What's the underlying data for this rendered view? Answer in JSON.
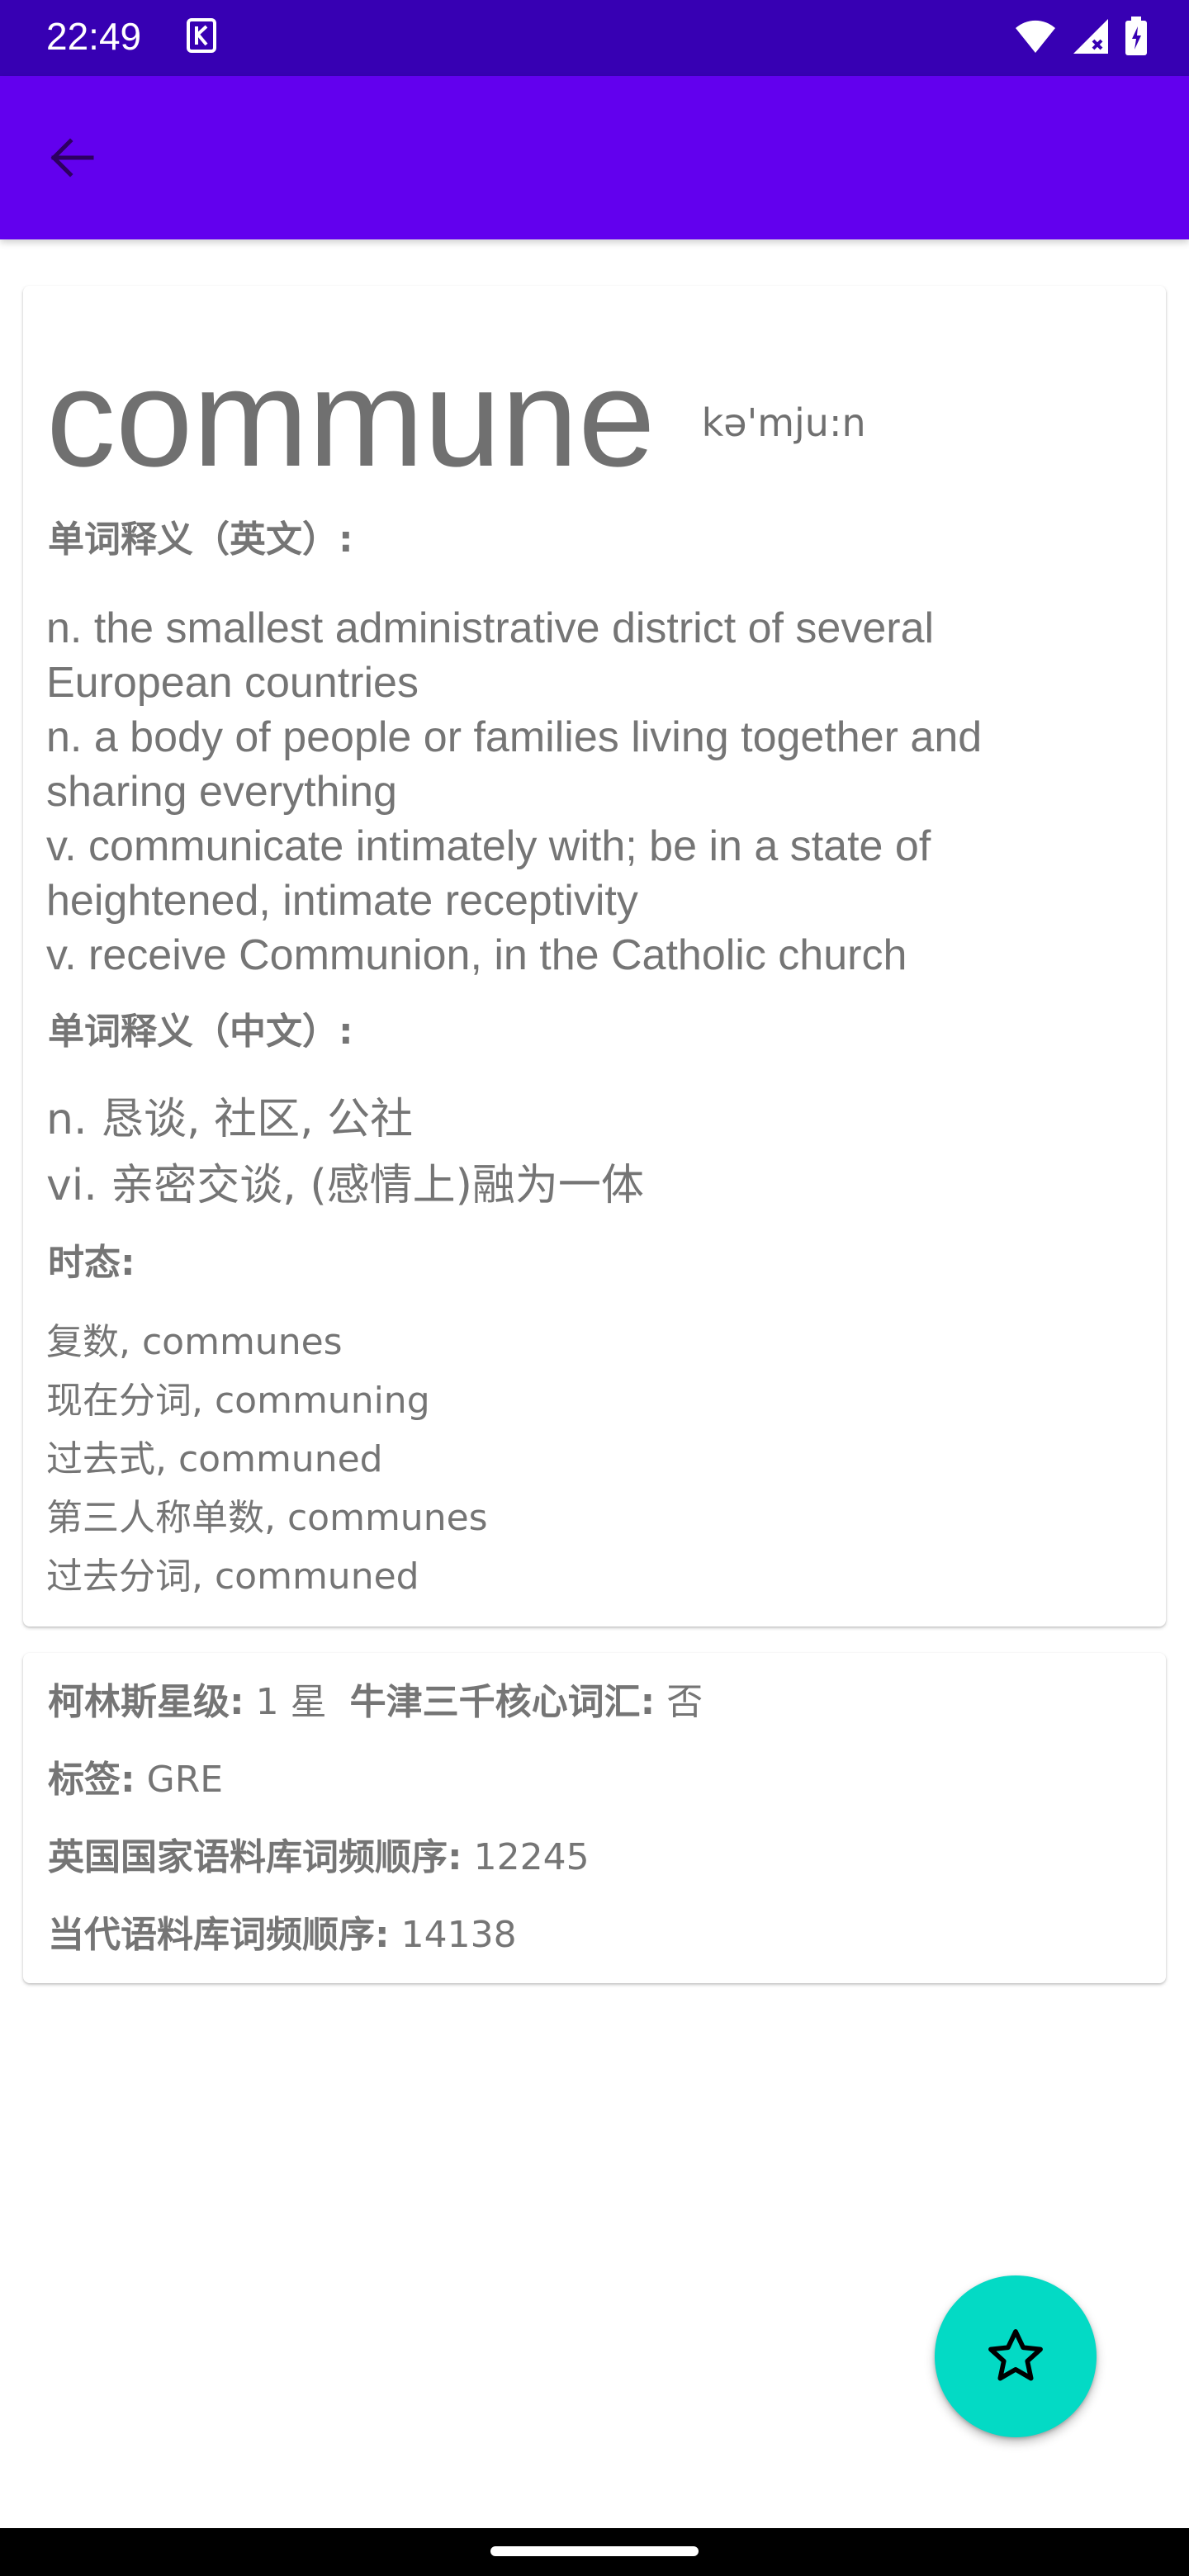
{
  "status_bar": {
    "time": "22:49",
    "notification_icon": "keyboard-app-icon",
    "icons": [
      "wifi-icon",
      "signal-icon",
      "battery-icon"
    ],
    "background": "#3700b3"
  },
  "app_bar": {
    "back_icon": "arrow-back-icon",
    "background": "#6200ee"
  },
  "word": {
    "text": "commune",
    "phonetic": "kə'mju:n"
  },
  "definitions_en": {
    "label": "单词释义（英文）:",
    "lines": [
      "n. the smallest administrative district of several",
      "European countries",
      "n. a body of people or families living together and",
      "sharing everything",
      "v. communicate intimately with; be in a state of",
      "heightened, intimate receptivity",
      "v. receive Communion, in the Catholic church"
    ]
  },
  "definitions_cn": {
    "label": "单词释义（中文）:",
    "lines": [
      "n. 恳谈, 社区, 公社",
      "vi. 亲密交谈, (感情上)融为一体"
    ]
  },
  "tenses": {
    "label": "时态:",
    "lines": [
      "复数, communes",
      "现在分词, communing",
      "过去式, communed",
      "第三人称单数, communes",
      "过去分词, communed"
    ]
  },
  "info": {
    "collins_label": "柯林斯星级:",
    "collins_value": "1 星",
    "oxford_label": "牛津三千核心词汇:",
    "oxford_value": "否",
    "tag_label": "标签:",
    "tag_value": "GRE",
    "bnc_label": "英国国家语料库词频顺序:",
    "bnc_value": "12245",
    "coca_label": "当代语料库词频顺序:",
    "coca_value": "14138"
  },
  "fab": {
    "icon": "star-outline-icon",
    "background": "#03dac5"
  }
}
